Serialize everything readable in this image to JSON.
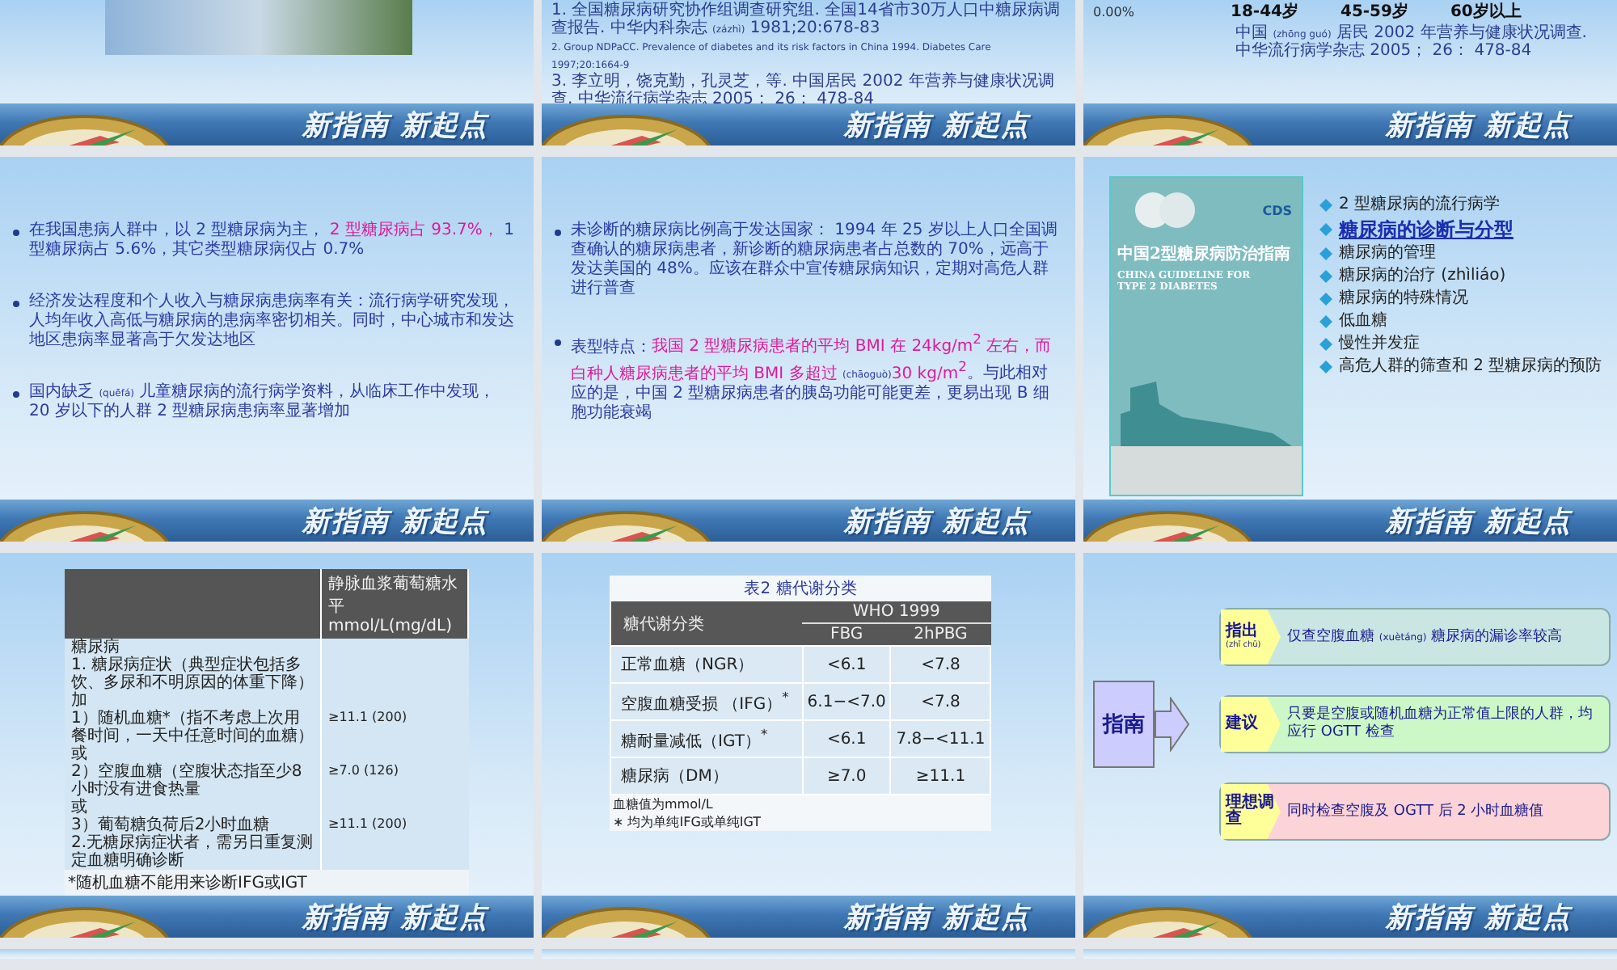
{
  "slides": [
    {
      "kind": "photo",
      "slogan": "新指南 新起点"
    },
    {
      "kind": "references",
      "references": [
        {
          "parts": [
            {
              "text": "1. 全国糖尿病研究协作组调查研究组. 全国14省市30万人口中糖尿病调查报告. 中华内科杂志 ",
              "kind": "plain"
            },
            {
              "text": "(zázhì)",
              "kind": "pinyin"
            },
            {
              "text": " 1981;20:678-83",
              "kind": "plain"
            }
          ]
        },
        {
          "parts": [
            {
              "text": "2. Group NDPaCC. Prevalence of diabetes and its risk factors in China 1994. Diabetes Care 1997;20:1664-9",
              "kind": "latin"
            }
          ]
        },
        {
          "parts": [
            {
              "text": "3. 李立明，饶克勤，孔灵芝，等. 中国居民 2002 年营养与健康状况调查. 中华流行病学杂志 2005； 26： 478-84",
              "kind": "plain"
            }
          ]
        }
      ],
      "slogan": "新指南 新起点"
    },
    {
      "kind": "chart_tail",
      "tick": "0.00%",
      "categories": [
        "18-44岁",
        "45-59岁",
        "60岁以上"
      ],
      "reference": [
        {
          "text": "中国 ",
          "kind": "plain"
        },
        {
          "text": "(zhōng guó)",
          "kind": "pinyin"
        },
        {
          "text": " 居民 2002 年营养与健康状况调查. 中华流行病学杂志 2005； 26： 478-84",
          "kind": "plain"
        }
      ],
      "slogan": "新指南 新起点"
    },
    {
      "kind": "bullets",
      "bullets": [
        {
          "parts": [
            {
              "text": "在我国患病人群中，以 2 型糖尿病为主， ",
              "kind": "plain"
            },
            {
              "text": "2 型糖尿病占 93.7%， ",
              "kind": "highlight"
            },
            {
              "text": "1 型糖尿病占 5.6%，其它类型糖尿病仅占 0.7%",
              "kind": "plain"
            }
          ]
        },
        {
          "parts": [
            {
              "text": "经济发达程度和个人收入与糖尿病患病率有关：流行病学研究发现，人均年收入高低与糖尿病的患病率密切相关。同时，中心城市和发达地区患病率显著高于欠发达地区",
              "kind": "plain"
            }
          ]
        },
        {
          "parts": [
            {
              "text": "国内缺乏 ",
              "kind": "plain"
            },
            {
              "text": "(quēfá)",
              "kind": "pinyin"
            },
            {
              "text": " 儿童糖尿病的流行病学资料，从临床工作中发现， 20 岁以下的人群 2 型糖尿病患病率显著增加",
              "kind": "plain"
            }
          ]
        }
      ],
      "slogan": "新指南 新起点"
    },
    {
      "kind": "bullets",
      "bullets": [
        {
          "parts": [
            {
              "text": "未诊断的糖尿病比例高于发达国家： 1994 年 25 岁以上人口全国调查确认的糖尿病患者，新诊断的糖尿病患者占总数的 70%，远高于发达美国的 48%。应该在群众中宣传糖尿病知识，定期对高危人群进行普查",
              "kind": "plain"
            }
          ]
        },
        {
          "parts": [
            {
              "text": "表型特点：",
              "kind": "plain"
            },
            {
              "text": "我国 2 型糖尿病患者的平均 BMI 在 24kg/m$^{2}$ 左右，而白种人糖尿病患者的平均 BMI 多超过 ",
              "kind": "highlight"
            },
            {
              "text": "(chāoguò)",
              "kind": "pinyin"
            },
            {
              "text": "30 kg/m$^{2}$",
              "kind": "highlight"
            },
            {
              "text": "。与此相对应的是，中国 2 型糖尿病患者的胰岛功能可能更差，更易出现 B 细胞功能衰竭",
              "kind": "plain"
            }
          ]
        }
      ],
      "slogan": "新指南 新起点"
    },
    {
      "kind": "cover",
      "cover": {
        "logo": "CDS",
        "title": "中国2型糖尿病防治指南",
        "subtitle": [
          "CHINA GUIDELINE FOR",
          "TYPE 2  DIABETES"
        ]
      },
      "topics": [
        {
          "text": "2 型糖尿病的流行病学",
          "selected": false
        },
        {
          "text": "糖尿病的诊断与分型",
          "selected": true
        },
        {
          "text": "糖尿病的管理",
          "selected": false
        },
        {
          "text": "糖尿病的治疗 (zhìliáo)",
          "selected": false
        },
        {
          "text": "糖尿病的特殊情况",
          "selected": false
        },
        {
          "text": "低血糖",
          "selected": false
        },
        {
          "text": "慢性并发症",
          "selected": false
        },
        {
          "text": "高危人群的筛查和 2 型糖尿病的预防",
          "selected": false
        }
      ],
      "slogan": "新指南 新起点"
    },
    {
      "kind": "criteria_table",
      "value_header": "静脉血浆葡萄糖水平mmol/L(mg/dL)",
      "rows": [
        {
          "criterion": "糖尿病"
        },
        {
          "criterion": "1. 糖尿病症状（典型症状包括多饮、多尿和不明原因的体重下降）加"
        },
        {
          "criterion": "1）随机血糖*（指不考虑上次用餐时间，一天中任意时间的血糖）",
          "value": "≥11.1 (200)"
        },
        {
          "criterion": "或"
        },
        {
          "criterion": "2）空腹血糖（空腹状态指至少8小时没有进食热量",
          "value": "≥7.0 (126)"
        },
        {
          "criterion": "或"
        },
        {
          "criterion": "3）葡萄糖负荷后2小时血糖",
          "value": "≥11.1 (200)"
        },
        {
          "criterion": "2.无糖尿病症状者，需另日重复测定血糖明确诊断"
        }
      ],
      "note": "*随机血糖不能用来诊断IFG或IGT",
      "slogan": "新指南 新起点"
    },
    {
      "kind": "class_table",
      "title": "表2  糖代谢分类",
      "name_header": "糖代谢分类",
      "group_header": "WHO 1999",
      "sub_headers": [
        "FBG",
        "2hPBG"
      ],
      "rows": [
        {
          "name": "正常血糖（NGR）",
          "values": [
            "<6.1",
            "<7.8"
          ]
        },
        {
          "name": "空腹血糖受损 （IFG）$^{*}$",
          "values": [
            "6.1−<7.0",
            "<7.8"
          ]
        },
        {
          "name": "糖耐量减低（IGT）$^{*}$",
          "values": [
            "<6.1",
            "7.8−<11.1"
          ]
        },
        {
          "name": "糖尿病（DM）",
          "values": [
            "≥7.0",
            "≥11.1"
          ]
        }
      ],
      "notes": [
        "血糖值为mmol/L",
        "∗ 均为单纯IFG或单纯IGT"
      ],
      "slogan": "新指南 新起点"
    },
    {
      "kind": "flow",
      "hub": "指南",
      "items": [
        {
          "label": [
            {
              "text": "指出",
              "kind": "plain"
            },
            {
              "text": " (zhǐ chū)",
              "kind": "pinyin"
            }
          ],
          "parts": [
            {
              "text": "仅查空腹血糖 ",
              "kind": "plain"
            },
            {
              "text": "(xuètáng)",
              "kind": "pinyin"
            },
            {
              "text": " 糖尿病的漏诊率较高",
              "kind": "plain"
            }
          ],
          "color": "#c9e6e3"
        },
        {
          "label": [
            {
              "text": "建议",
              "kind": "plain"
            }
          ],
          "parts": [
            {
              "text": "只要是空腹或随机血糖为正常值上限的人群，均应行 OGTT 检查",
              "kind": "plain"
            }
          ],
          "color": "#ccf7c6"
        },
        {
          "label": [
            {
              "text": "理想调查",
              "kind": "plain"
            }
          ],
          "parts": [
            {
              "text": "同时检查空腹及 OGTT 后 2 小时血糖值",
              "kind": "plain"
            }
          ],
          "color": "#fcd3d6"
        }
      ],
      "slogan": "新指南 新起点"
    },
    {
      "kind": "blank"
    },
    {
      "kind": "blank"
    },
    {
      "kind": "blank"
    }
  ]
}
